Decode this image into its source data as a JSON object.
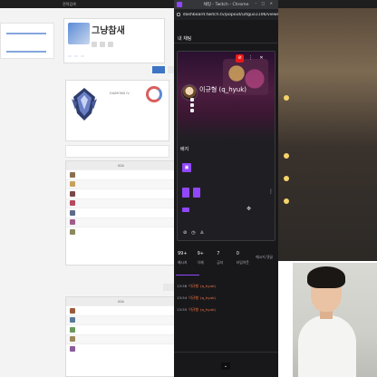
{
  "background_page": {
    "topbar_items": [
      "",
      "전적검색",
      "",
      "",
      "",
      "",
      ""
    ],
    "profile": {
      "name": "그냥참새",
      "meta": "",
      "stats": [
        "",
        "",
        ""
      ]
    },
    "renew_label": "",
    "rank": {
      "label": "",
      "lines": [
        "",
        "",
        "DIAMOND IV"
      ],
      "footer": ""
    },
    "tier_chip": "",
    "table_top": {
      "header": [
        "",
        "",
        "",
        "KDA",
        "",
        "",
        ""
      ],
      "rows": [
        {
          "name": "",
          "vals": [
            "",
            "",
            "",
            "",
            "",
            ""
          ],
          "color": "#8a6f4f"
        },
        {
          "name": "",
          "vals": [
            "",
            "",
            "",
            "",
            "",
            ""
          ],
          "color": "#c9a15e"
        },
        {
          "name": "",
          "vals": [
            "",
            "",
            "",
            "",
            "",
            ""
          ],
          "color": "#7a4848"
        },
        {
          "name": "",
          "vals": [
            "",
            "",
            "",
            "",
            "",
            ""
          ],
          "color": "#b84a5e"
        },
        {
          "name": "",
          "vals": [
            "",
            "",
            "",
            "",
            "",
            ""
          ],
          "color": "#5e6b8a"
        },
        {
          "name": "",
          "vals": [
            "",
            "",
            "",
            "",
            "",
            ""
          ],
          "color": "#a25e8a"
        },
        {
          "name": "",
          "vals": [
            "",
            "",
            "",
            "",
            "",
            ""
          ],
          "color": "#8a8a5e"
        }
      ]
    },
    "table_bottom": {
      "header": [
        "",
        "",
        "",
        "KDA",
        "",
        "",
        ""
      ],
      "rows": [
        {
          "name": "",
          "vals": [
            "",
            "",
            "",
            "",
            "",
            ""
          ],
          "color": "#9a5b3c"
        },
        {
          "name": "",
          "vals": [
            "",
            "",
            "",
            "",
            "",
            ""
          ],
          "color": "#5b7a9a"
        },
        {
          "name": "",
          "vals": [
            "",
            "",
            "",
            "",
            "",
            ""
          ],
          "color": "#6a9a5b"
        },
        {
          "name": "",
          "vals": [
            "",
            "",
            "",
            "",
            "",
            ""
          ],
          "color": "#9a8a5b"
        },
        {
          "name": "",
          "vals": [
            "",
            "",
            "",
            "",
            "",
            ""
          ],
          "color": "#8a5b9a"
        }
      ]
    }
  },
  "twitch_window": {
    "title": "채팅 - Twitch - Chrome",
    "address": "dashboard.twitch.tv/popout/u/tguo1106/viewercard",
    "chat_header": "내 채팅",
    "user_card": {
      "top_note": "",
      "top_note_2": "",
      "username": "이규형 (q_hyuk)",
      "info_lines": [
        "",
        "",
        ""
      ],
      "section_label": "배지",
      "badge_label": "",
      "buttons_row1": [
        "",
        ""
      ],
      "button_row2": "",
      "stats": [
        {
          "value": "99+",
          "label": "메시지"
        },
        {
          "value": "9+",
          "label": "삭제"
        },
        {
          "value": "7",
          "label": "금지"
        },
        {
          "value": "0",
          "label": "타임아웃"
        },
        {
          "value": "",
          "label": "메시지 댓글"
        }
      ]
    },
    "chat_lines": [
      {
        "time": "13:58",
        "user": "이규형",
        "handle": "(q_hyuk)",
        "text": ""
      },
      {
        "time": "13:54",
        "user": "이규형",
        "handle": "(q_hyuk)",
        "text": ""
      },
      {
        "time": "13:55",
        "user": "이규형",
        "handle": "(q_hyuk)",
        "text": ""
      }
    ]
  },
  "overlay": {
    "alerts": [
      {
        "text": "",
        "color": "a-yellow"
      },
      {
        "text": "",
        "color": "a-white"
      },
      {
        "text": "",
        "color": "a-yellow"
      },
      {
        "text": "",
        "color": "a-white"
      },
      {
        "text": "",
        "color": "a-white"
      },
      {
        "text": "",
        "color": "a-yellow"
      },
      {
        "text": "",
        "color": "a-green"
      },
      {
        "text": "",
        "color": "a-white"
      },
      {
        "text": "",
        "color": "a-red"
      }
    ]
  },
  "colors": {
    "twitch_purple": "#9147ff",
    "twitch_bg": "#18181b",
    "danger_red": "#e91916"
  }
}
